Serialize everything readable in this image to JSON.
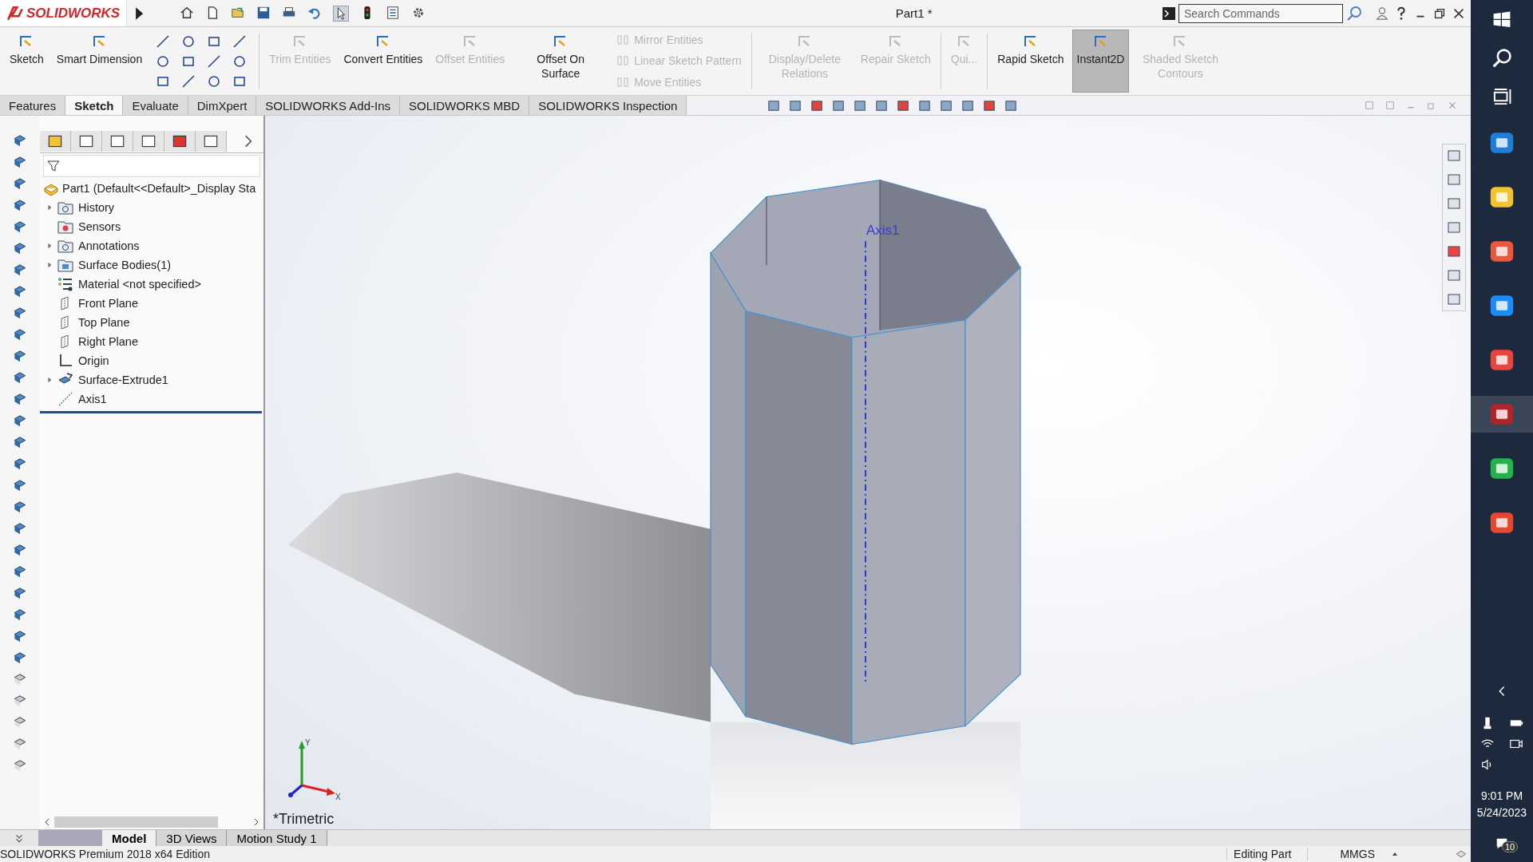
{
  "title_bar": {
    "logo": "SOLIDWORKS",
    "title": "Part1 *",
    "search": {
      "placeholder": "Search Commands"
    }
  },
  "ribbon": [
    {
      "kind": "large",
      "label": "Sketch",
      "disabled": false,
      "pressed": false
    },
    {
      "kind": "large",
      "label": "Smart Dimension",
      "disabled": false,
      "pressed": false
    },
    {
      "kind": "tools"
    },
    {
      "kind": "separator"
    },
    {
      "kind": "large",
      "label": "Trim Entities",
      "disabled": true,
      "pressed": false
    },
    {
      "kind": "large",
      "label": "Convert Entities",
      "disabled": false,
      "pressed": false
    },
    {
      "kind": "large",
      "label": "Offset Entities",
      "disabled": true,
      "pressed": false
    },
    {
      "kind": "large",
      "label": "Offset On Surface",
      "disabled": false,
      "pressed": false
    },
    {
      "kind": "stack",
      "items": [
        {
          "label": "Mirror Entities",
          "disabled": true
        },
        {
          "label": "Linear Sketch Pattern",
          "disabled": true
        },
        {
          "label": "Move Entities",
          "disabled": true
        }
      ]
    },
    {
      "kind": "separator"
    },
    {
      "kind": "large",
      "label": "Display/Delete Relations",
      "disabled": true,
      "pressed": false
    },
    {
      "kind": "large",
      "label": "Repair Sketch",
      "disabled": true,
      "pressed": false
    },
    {
      "kind": "separator"
    },
    {
      "kind": "large",
      "label": "Qui...",
      "disabled": true,
      "pressed": false
    },
    {
      "kind": "separator"
    },
    {
      "kind": "large",
      "label": "Rapid Sketch",
      "disabled": false,
      "pressed": false
    },
    {
      "kind": "large",
      "label": "Instant2D",
      "disabled": false,
      "pressed": true
    },
    {
      "kind": "large",
      "label": "Shaded Sketch Contours",
      "disabled": true,
      "pressed": false
    }
  ],
  "tabs": [
    {
      "label": "Features",
      "selected": false
    },
    {
      "label": "Sketch",
      "selected": true
    },
    {
      "label": "Evaluate",
      "selected": false
    },
    {
      "label": "DimXpert",
      "selected": false
    },
    {
      "label": "SOLIDWORKS Add-Ins",
      "selected": false
    },
    {
      "label": "SOLIDWORKS MBD",
      "selected": false
    },
    {
      "label": "SOLIDWORKS Inspection",
      "selected": false
    }
  ],
  "feature_tree": {
    "root": "Part1  (Default<<Default>_Display Sta",
    "items": [
      {
        "kind": "folder",
        "label": "History",
        "expanded": false
      },
      {
        "kind": "sensor",
        "label": "Sensors"
      },
      {
        "kind": "annotation",
        "label": "Annotations",
        "expanded": false
      },
      {
        "kind": "bodies",
        "label": "Surface Bodies(1)",
        "expanded": false
      },
      {
        "kind": "material",
        "label": "Material <not specified>"
      },
      {
        "kind": "plane",
        "label": "Front Plane"
      },
      {
        "kind": "plane",
        "label": "Top Plane"
      },
      {
        "kind": "plane",
        "label": "Right Plane"
      },
      {
        "kind": "origin",
        "label": "Origin"
      },
      {
        "kind": "feature",
        "label": "Surface-Extrude1",
        "expanded": false
      },
      {
        "kind": "axis",
        "label": "Axis1"
      }
    ]
  },
  "viewport": {
    "axis_label": "Axis1",
    "view_name": "*Trimetric",
    "triad": {
      "y": "Y",
      "x": "X"
    }
  },
  "bottom_tabs": [
    {
      "label": "Model",
      "selected": true
    },
    {
      "label": "3D Views",
      "selected": false
    },
    {
      "label": "Motion Study 1",
      "selected": false
    }
  ],
  "status_bar": {
    "edition": "SOLIDWORKS Premium 2018 x64 Edition",
    "mode": "Editing Part",
    "units": "MMGS"
  },
  "taskbar": {
    "time": "9:01 PM",
    "date": "5/24/2023",
    "notifications": "10"
  }
}
